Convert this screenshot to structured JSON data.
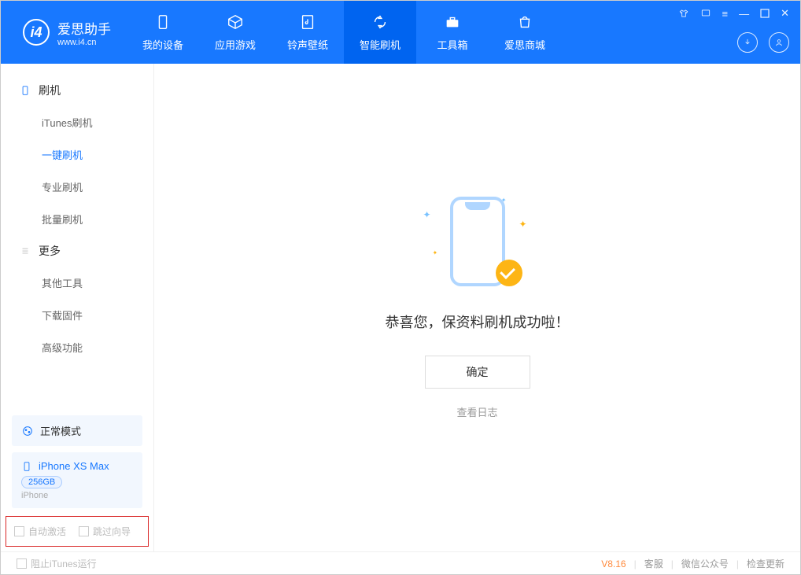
{
  "logo": {
    "main": "爱思助手",
    "sub": "www.i4.cn",
    "initial": "i4"
  },
  "nav": [
    {
      "label": "我的设备"
    },
    {
      "label": "应用游戏"
    },
    {
      "label": "铃声壁纸"
    },
    {
      "label": "智能刷机"
    },
    {
      "label": "工具箱"
    },
    {
      "label": "爱思商城"
    }
  ],
  "sidebar": {
    "group1": "刷机",
    "items1": [
      "iTunes刷机",
      "一键刷机",
      "专业刷机",
      "批量刷机"
    ],
    "group2": "更多",
    "items2": [
      "其他工具",
      "下载固件",
      "高级功能"
    ]
  },
  "mode_box": "正常模式",
  "device": {
    "name": "iPhone XS Max",
    "capacity": "256GB",
    "type": "iPhone"
  },
  "opts": {
    "auto_activate": "自动激活",
    "skip_guide": "跳过向导"
  },
  "main": {
    "success": "恭喜您，保资料刷机成功啦！",
    "ok": "确定",
    "log": "查看日志"
  },
  "footer": {
    "block_itunes": "阻止iTunes运行",
    "version": "V8.16",
    "service": "客服",
    "wechat": "微信公众号",
    "update": "检查更新"
  }
}
